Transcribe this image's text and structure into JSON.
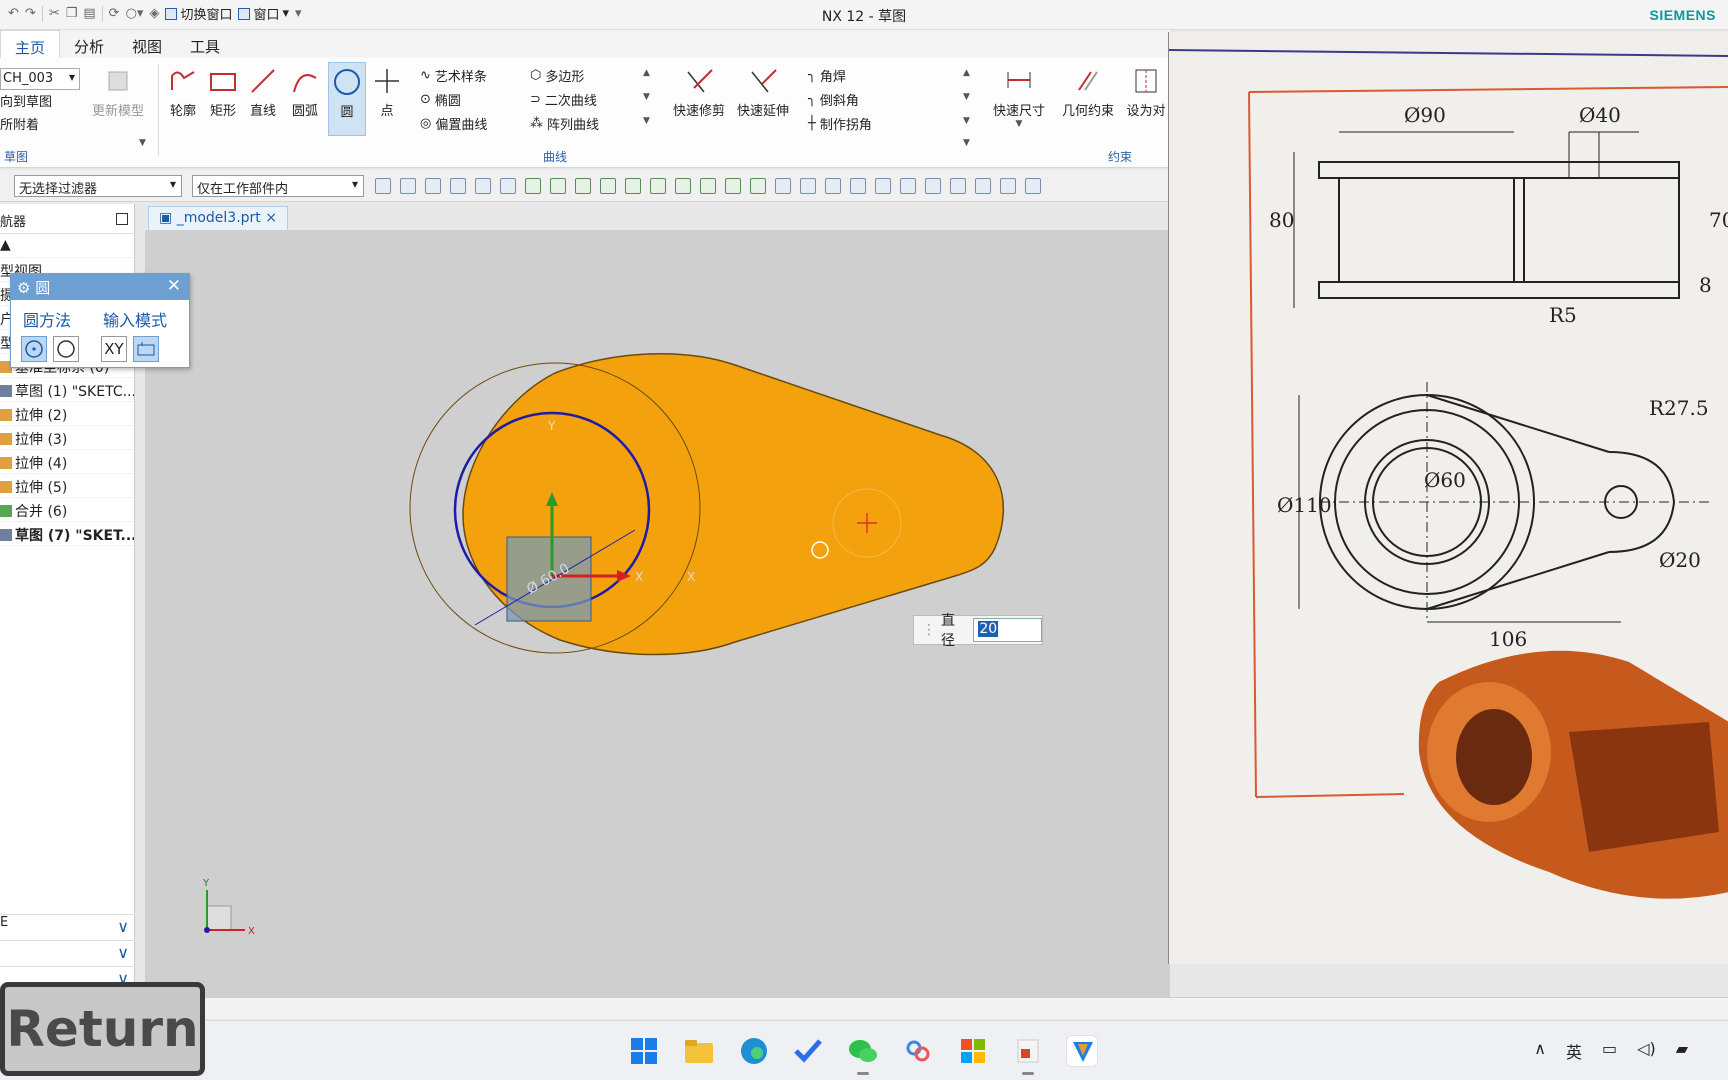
{
  "window": {
    "title": "NX 12 - 草图",
    "brand": "SIEMENS",
    "qat_switch_window": "切换窗口",
    "qat_window": "窗口"
  },
  "menu_tabs": [
    "主页",
    "分析",
    "视图",
    "工具"
  ],
  "ribbon": {
    "sketch_name": "CH_003",
    "sketch_lines": [
      "向到草图",
      "所附着"
    ],
    "update_model": "更新模型",
    "group_sketch": "草图",
    "big_buttons": [
      "轮廓",
      "矩形",
      "直线",
      "圆弧",
      "圆",
      "点"
    ],
    "curve_small_col1": [
      "艺术样条",
      "椭圆",
      "偏置曲线"
    ],
    "curve_small_col2": [
      "多边形",
      "二次曲线",
      "阵列曲线"
    ],
    "group_curve": "曲线",
    "quick_trim": "快速修剪",
    "quick_extend": "快速延伸",
    "corner_items": [
      "角焊",
      "倒斜角",
      "制作拐角"
    ],
    "quick_dimension": "快速尺寸",
    "geometric_constraints": "几何约束",
    "set_as_symmetric": "设为对",
    "group_constraints": "约束"
  },
  "filterbar": {
    "selection_filter": "无选择过滤器",
    "scope": "仅在工作部件内"
  },
  "navigator": {
    "title": "航器",
    "rows": [
      {
        "label": "型视图",
        "icon": "none",
        "bold": false
      },
      {
        "label": "摄",
        "icon": "none",
        "bold": false
      },
      {
        "label": "户",
        "icon": "none",
        "bold": false
      },
      {
        "label": "型",
        "icon": "none",
        "bold": false
      },
      {
        "label": "基准坐标系 (0)",
        "icon": "datum",
        "bold": false
      },
      {
        "label": "草图 (1) \"SKETC...",
        "icon": "sketch",
        "bold": false
      },
      {
        "label": "拉伸 (2)",
        "icon": "extrude",
        "bold": false
      },
      {
        "label": "拉伸 (3)",
        "icon": "extrude",
        "bold": false
      },
      {
        "label": "拉伸 (4)",
        "icon": "extrude",
        "bold": false
      },
      {
        "label": "拉伸 (5)",
        "icon": "extrude",
        "bold": false
      },
      {
        "label": "合并 (6)",
        "icon": "unite",
        "bold": false
      },
      {
        "label": "草图 (7) \"SKET...",
        "icon": "sketch",
        "bold": true
      }
    ],
    "footer_rows": [
      "E",
      "",
      ""
    ]
  },
  "circle_dialog": {
    "title": "圆",
    "method_label": "圆方法",
    "input_mode_label": "输入模式",
    "xy_label": "XY"
  },
  "model_tab": "_model3.prt",
  "graphics": {
    "diameter_label": "直径",
    "diameter_value": "20",
    "axis_x": "X",
    "axis_y": "Y",
    "dimension_text": "Ø 60.0"
  },
  "drawing": {
    "dims": [
      "Ø90",
      "Ø40",
      "80",
      "70",
      "8",
      "R5",
      "R27.5",
      "Ø110",
      "Ø60",
      "Ø20",
      "106"
    ]
  },
  "overlay": {
    "return_label": "Return"
  },
  "tray": {
    "ime": "英"
  }
}
